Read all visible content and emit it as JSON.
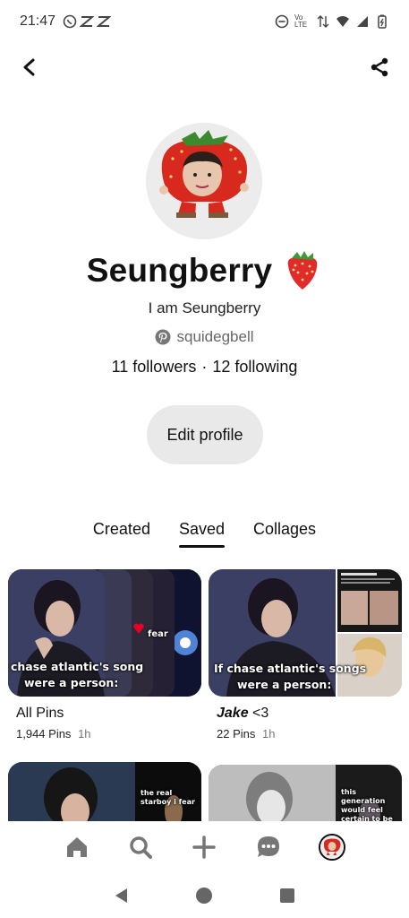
{
  "status": {
    "time": "21:47",
    "lte_label": "Vo LTE"
  },
  "profile": {
    "name": "Seungberry",
    "bio": "I am Seungberry",
    "username": "squidegbell",
    "followers": "11 followers",
    "separator": "·",
    "following": "12 following",
    "edit_label": "Edit profile"
  },
  "tabs": [
    {
      "label": "Created"
    },
    {
      "label": "Saved"
    },
    {
      "label": "Collages"
    }
  ],
  "boards": [
    {
      "title": "All Pins",
      "pins": "1,944 Pins",
      "time": "1h",
      "caption_line1": "chase atlantic's song",
      "caption_line2": "were a person:",
      "thumb_text": "fear"
    },
    {
      "title_italic": "Jake",
      "title_rest": " <3",
      "pins": "22 Pins",
      "time": "1h",
      "caption_line1": "If chase atlantic's songs",
      "caption_line2": "were a person:"
    }
  ],
  "partial_boards": [
    {
      "side_text": "the real starboy i fear"
    },
    {
      "side_text": "this generation would feel certain to be"
    }
  ],
  "colors": {
    "accent": "#e60023",
    "chip_bg": "#e9e9e9",
    "text": "#111111",
    "muted": "#666666"
  }
}
